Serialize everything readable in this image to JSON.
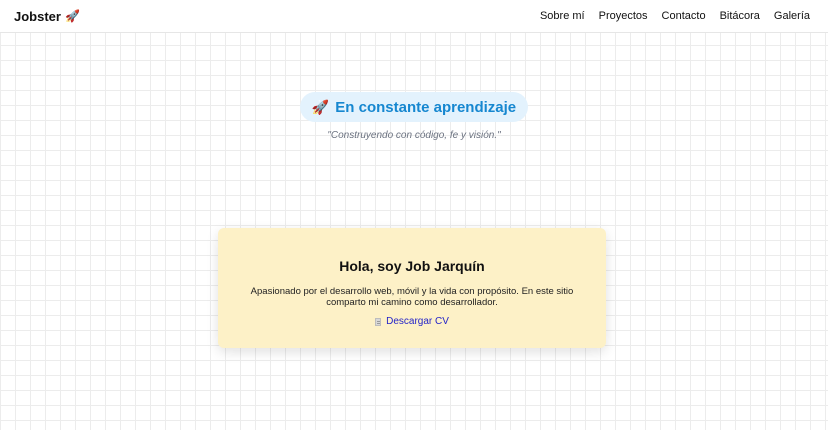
{
  "navbar": {
    "brand": "Jobster",
    "brand_icon": "rocket-icon",
    "links": [
      "Sobre mí",
      "Proyectos",
      "Contacto",
      "Bitácora",
      "Galería"
    ]
  },
  "hero": {
    "pill_icon": "rocket-icon",
    "pill_text": "En constante aprendizaje",
    "motto": "\"Construyendo con código, fe y visión.\""
  },
  "card": {
    "title": "Hola, soy Job Jarquín",
    "description": "Apasionado por el desarrollo web, móvil y la vida con propósito. En este sitio comparto mi camino como desarrollador.",
    "cv_icon": "document-icon",
    "cv_label": "Descargar CV"
  },
  "colors": {
    "pill_bg": "#e3f2fd",
    "pill_text": "#1687d0",
    "card_bg": "#fdf1c7",
    "link": "#2424c8"
  }
}
